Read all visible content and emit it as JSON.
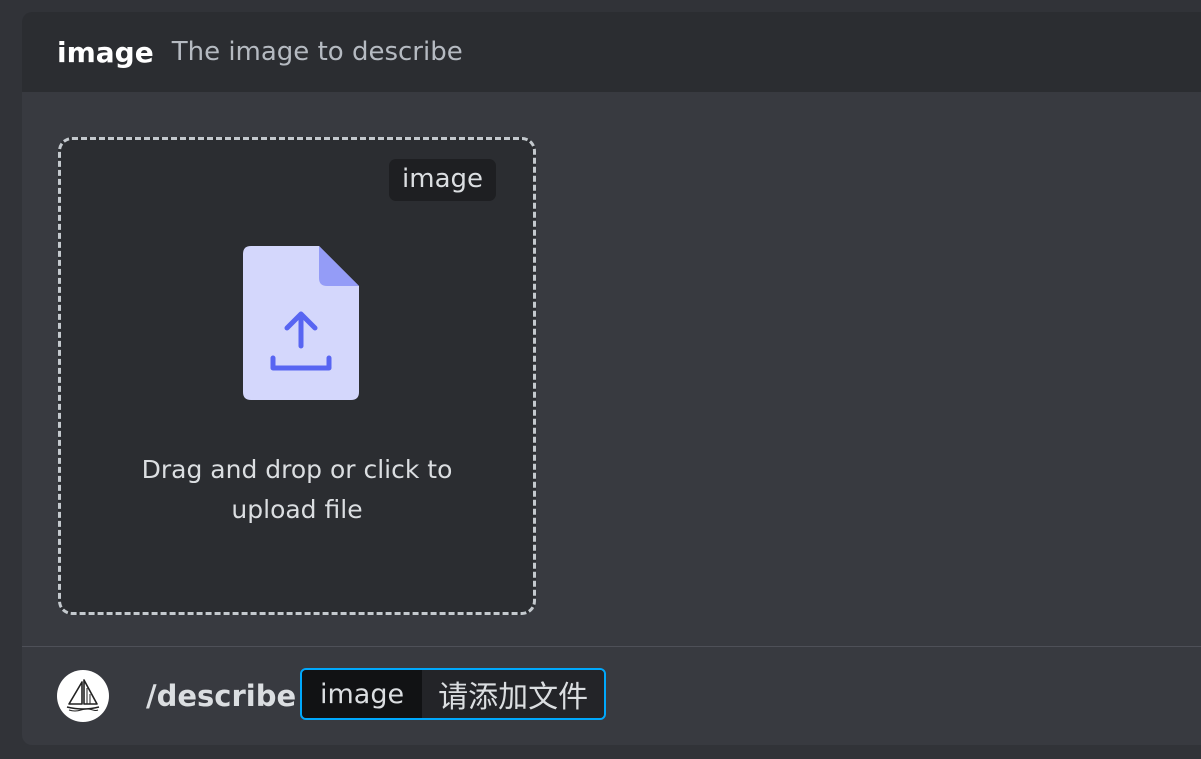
{
  "header": {
    "option_name": "image",
    "option_description": "The image to describe"
  },
  "dropzone": {
    "tag": "image",
    "text_line1": "Drag and drop or click to",
    "text_line2": "upload file",
    "icon": "file-upload-icon"
  },
  "composer": {
    "avatar_icon": "sailboat-logo-icon",
    "command": "/describe",
    "option_name": "image",
    "option_value": "请添加文件"
  },
  "colors": {
    "accent": "#00a8fc",
    "file_icon_body": "#d4d7fc",
    "file_icon_fold": "#949cf7",
    "file_icon_arrow": "#5865f2"
  }
}
